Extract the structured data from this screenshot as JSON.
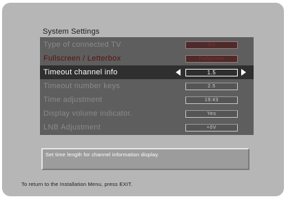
{
  "screen": {
    "title": "System Settings",
    "menu": {
      "rows": [
        {
          "label": "Type of connected TV",
          "value": "4/3"
        },
        {
          "label": "Fullscreen / Letterbox",
          "value": "Fullscreen"
        },
        {
          "label": "Timeout channel info",
          "value": "1.5"
        },
        {
          "label": "Timeout number keys",
          "value": "2.5"
        },
        {
          "label": "Time adjustment",
          "value": "19:43"
        },
        {
          "label": "Display volume indicator.",
          "value": "Yes"
        },
        {
          "label": "LNB Adjustment",
          "value": "+0V"
        }
      ],
      "selected_index": 2
    },
    "help_text": "Set time length for channel information display.",
    "footer": "To return to the Installation Menu, press EXIT."
  },
  "colors": {
    "screen_bg": "#b6b6b6",
    "menu_bg": "#5e5e5e",
    "selected_bg": "#2f2f2f",
    "dim_text": "#8a8a8a",
    "red_text": "#5a1010"
  },
  "icons": {
    "left": "triangle-left-icon",
    "right": "triangle-right-icon"
  }
}
